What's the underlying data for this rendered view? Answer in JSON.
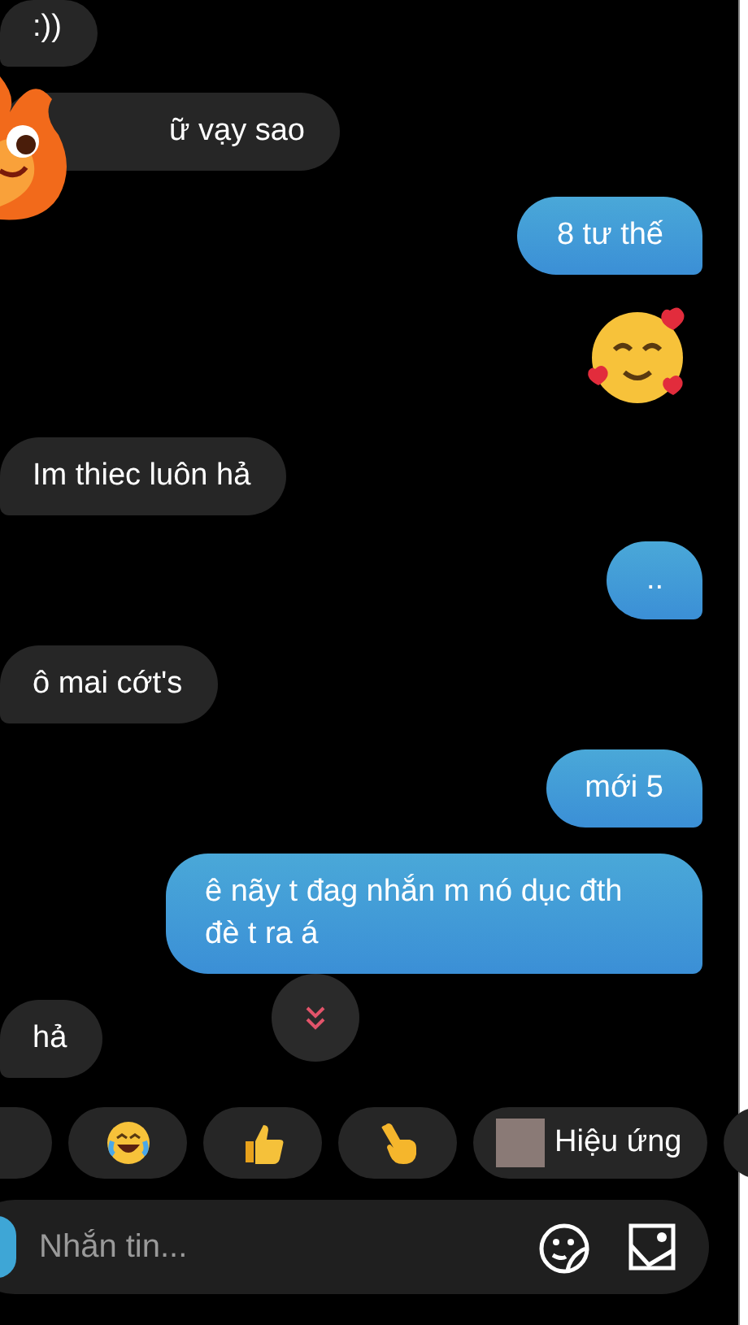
{
  "messages": [
    {
      "outgoing": false,
      "kind": "text",
      "text": ":))"
    },
    {
      "outgoing": false,
      "kind": "text",
      "text": "ữ vạy sao",
      "sticker": true
    },
    {
      "outgoing": true,
      "kind": "text",
      "text": "8 tư thế"
    },
    {
      "outgoing": true,
      "kind": "emoji"
    },
    {
      "outgoing": false,
      "kind": "text",
      "text": "Im thiec luôn hả"
    },
    {
      "outgoing": true,
      "kind": "text",
      "text": ".."
    },
    {
      "outgoing": false,
      "kind": "text",
      "text": "ô mai cớt's"
    },
    {
      "outgoing": true,
      "kind": "text",
      "text": "mới 5"
    },
    {
      "outgoing": true,
      "kind": "text",
      "text": "ê nãy t đag nhắn m nó dục đth đè t ra á"
    },
    {
      "outgoing": false,
      "kind": "text",
      "text": "hả"
    }
  ],
  "quick_replies": [
    {
      "kind": "partial"
    },
    {
      "kind": "laugh"
    },
    {
      "kind": "thumbs"
    },
    {
      "kind": "point"
    },
    {
      "kind": "effect",
      "label": "Hiệu ứng"
    },
    {
      "kind": "partial"
    }
  ],
  "composer": {
    "placeholder": "Nhắn tin..."
  }
}
